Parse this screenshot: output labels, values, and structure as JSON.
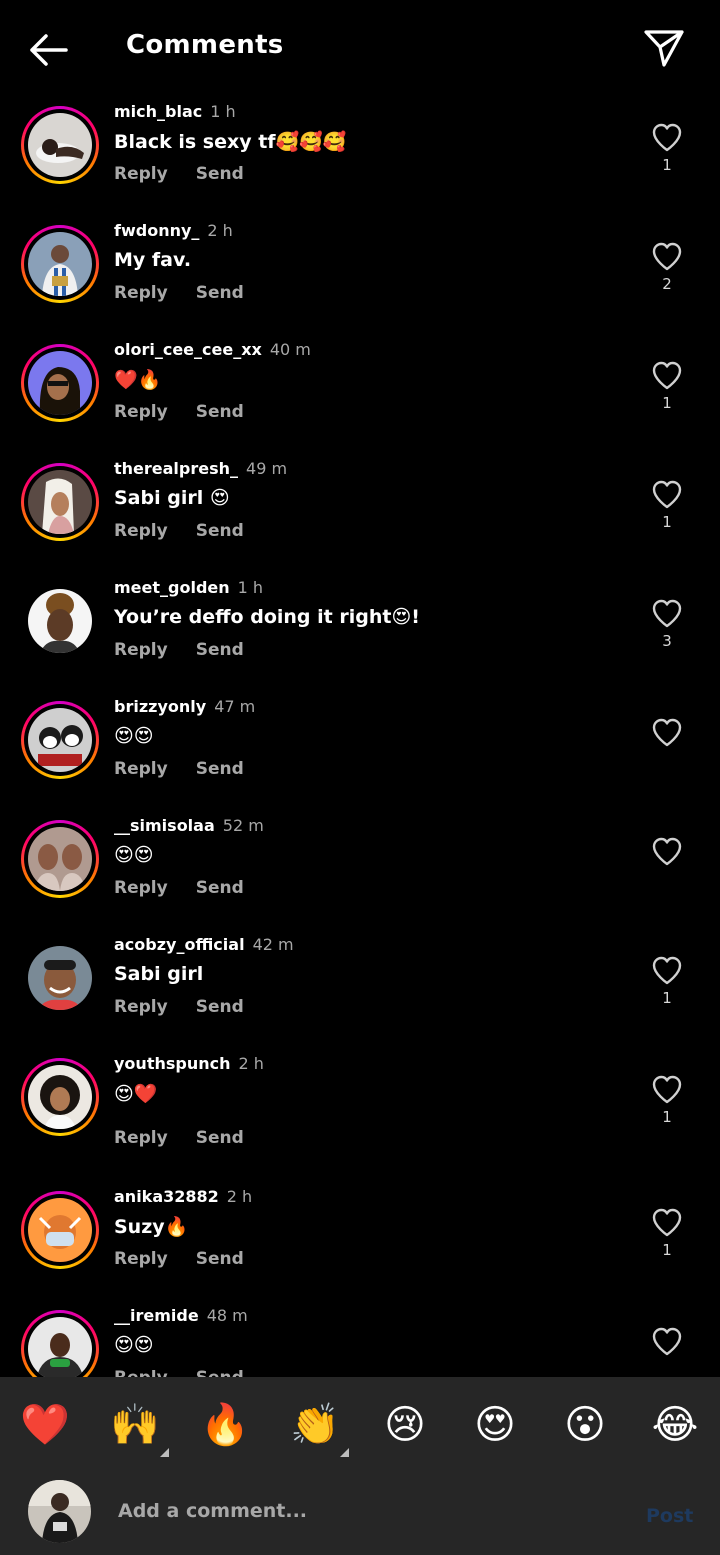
{
  "header": {
    "title": "Comments"
  },
  "comments": [
    {
      "username": "mich_blac",
      "time": "1 h",
      "text": "Black is sexy tf🥰🥰🥰",
      "reply": "Reply",
      "send": "Send",
      "likes": "1",
      "ring": true
    },
    {
      "username": "fwdonny_",
      "time": "2 h",
      "text": "My fav.",
      "reply": "Reply",
      "send": "Send",
      "likes": "2",
      "ring": true
    },
    {
      "username": "olori_cee_cee_xx",
      "time": "40 m",
      "text": "❤️🔥",
      "reply": "Reply",
      "send": "Send",
      "likes": "1",
      "ring": true
    },
    {
      "username": "therealpresh_",
      "time": "49 m",
      "text": "Sabi girl 😍",
      "reply": "Reply",
      "send": "Send",
      "likes": "1",
      "ring": true
    },
    {
      "username": "meet_golden",
      "time": "1 h",
      "text": "You’re deffo doing it right😍!",
      "reply": "Reply",
      "send": "Send",
      "likes": "3",
      "ring": false
    },
    {
      "username": "brizzyonly",
      "time": "47 m",
      "text": "😍😍",
      "reply": "Reply",
      "send": "Send",
      "likes": "",
      "ring": true
    },
    {
      "username": "__simisolaa",
      "time": "52 m",
      "text": "😍😍",
      "reply": "Reply",
      "send": "Send",
      "likes": "",
      "ring": true
    },
    {
      "username": "acobzy_official",
      "time": "42 m",
      "text": "Sabi girl",
      "reply": "Reply",
      "send": "Send",
      "likes": "1",
      "ring": false
    },
    {
      "username": "youthspunch",
      "time": "2 h",
      "text": "😍❤️",
      "reply": "Reply",
      "send": "Send",
      "likes": "1",
      "ring": true
    },
    {
      "username": "anika32882",
      "time": "2 h",
      "text": "Suzy🔥",
      "reply": "Reply",
      "send": "Send",
      "likes": "1",
      "ring": true
    },
    {
      "username": "__iremide",
      "time": "48 m",
      "text": "😍😍",
      "reply": "Reply",
      "send": "Send",
      "likes": "",
      "ring": true
    }
  ],
  "emoji_bar": [
    {
      "glyph": "❤️",
      "name": "heart",
      "has_variants": false
    },
    {
      "glyph": "🙌",
      "name": "raising-hands",
      "has_variants": true
    },
    {
      "glyph": "🔥",
      "name": "fire",
      "has_variants": false
    },
    {
      "glyph": "👏",
      "name": "clapping-hands",
      "has_variants": true
    },
    {
      "glyph": "😢",
      "name": "crying-face",
      "has_variants": false
    },
    {
      "glyph": "😍",
      "name": "heart-eyes",
      "has_variants": false
    },
    {
      "glyph": "😮",
      "name": "surprised-face",
      "has_variants": false
    },
    {
      "glyph": "😂",
      "name": "tears-of-joy",
      "has_variants": false
    }
  ],
  "composer": {
    "placeholder": "Add a comment...",
    "post_label": "Post"
  },
  "colors": {
    "background": "#000000",
    "secondary_text": "#a8a8a8",
    "bar_background": "#262626",
    "post_disabled": "#1e3a5f"
  },
  "icons": {
    "back": "arrow-left-icon",
    "share": "paper-plane-icon",
    "like": "heart-outline-icon"
  }
}
